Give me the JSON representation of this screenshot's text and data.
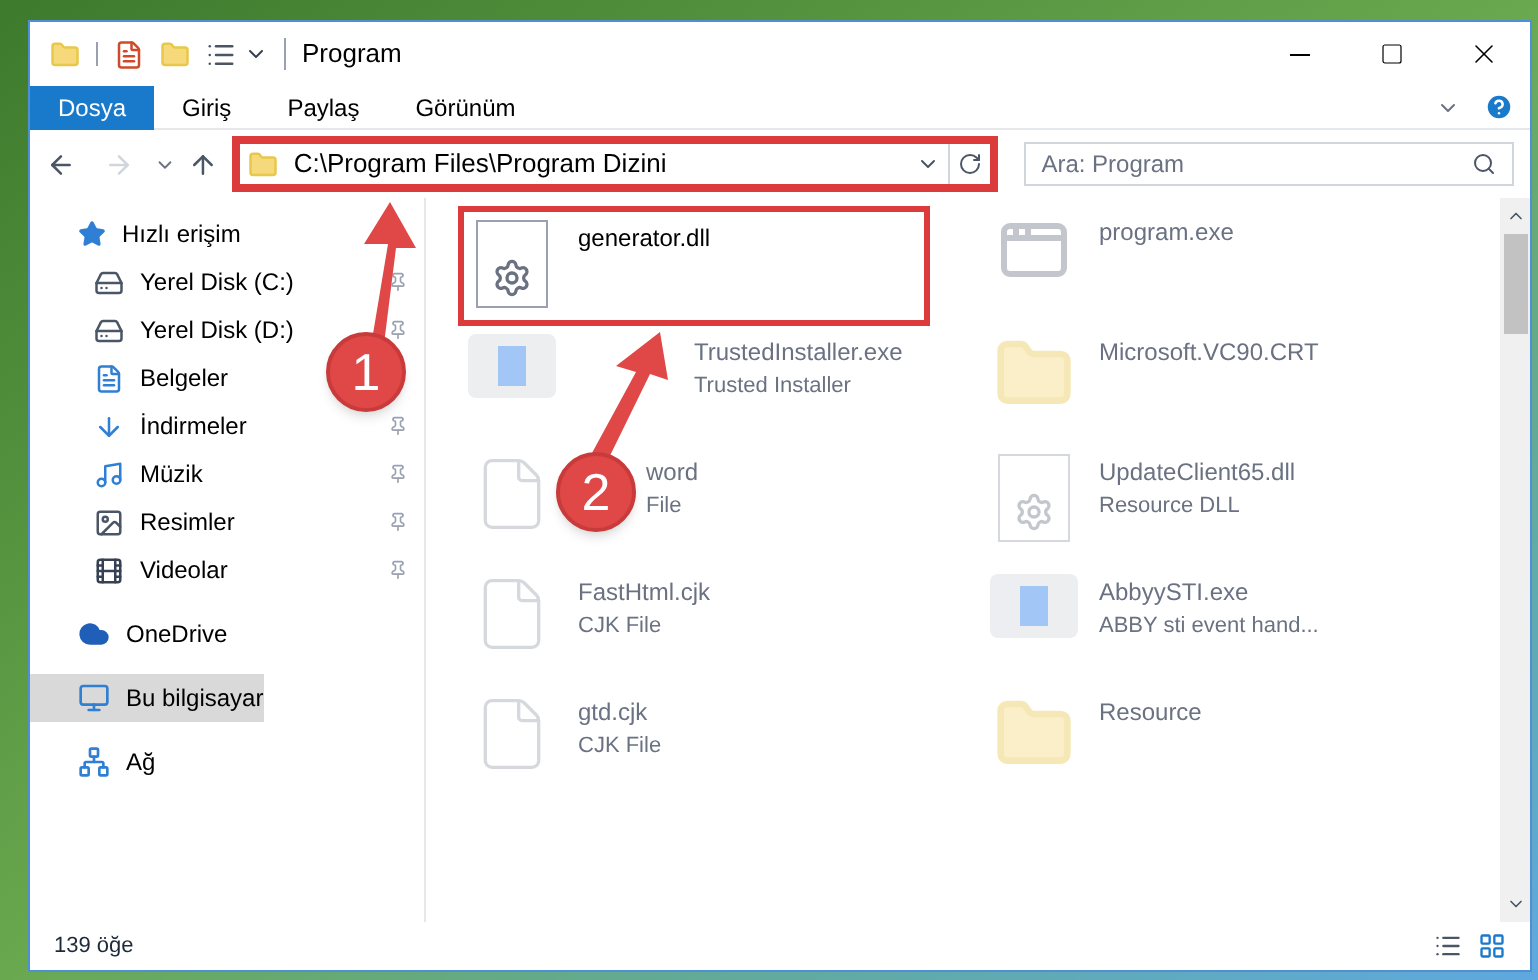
{
  "window": {
    "title": "Program"
  },
  "ribbon_tabs": [
    {
      "label": "Dosya",
      "selected": true
    },
    {
      "label": "Giriş",
      "selected": false
    },
    {
      "label": "Paylaş",
      "selected": false
    },
    {
      "label": "Görünüm",
      "selected": false
    }
  ],
  "address": {
    "path": "C:\\Program Files\\Program Dizini",
    "highlighted": true
  },
  "search": {
    "placeholder": "Ara: Program"
  },
  "sidebar": {
    "items": [
      {
        "label": "Hızlı erişim",
        "kind": "star",
        "selected": false,
        "children": [
          {
            "label": "Yerel Disk (C:)",
            "kind": "drive",
            "pinned": true,
            "selected": false
          },
          {
            "label": "Yerel Disk (D:)",
            "kind": "drive",
            "pinned": true,
            "selected": false
          },
          {
            "label": "Belgeler",
            "kind": "docs",
            "pinned": false,
            "selected": false
          },
          {
            "label": "İndirmeler",
            "kind": "download",
            "pinned": true,
            "selected": false
          },
          {
            "label": "Müzik",
            "kind": "music",
            "pinned": true,
            "selected": false
          },
          {
            "label": "Resimler",
            "kind": "pictures",
            "pinned": true,
            "selected": false
          },
          {
            "label": "Videolar",
            "kind": "video",
            "pinned": true,
            "selected": false
          }
        ]
      },
      {
        "label": "OneDrive",
        "kind": "cloud",
        "selected": false
      },
      {
        "label": "Bu bilgisayar",
        "kind": "computer",
        "selected": true
      },
      {
        "label": "Ağ",
        "kind": "network",
        "selected": false
      }
    ]
  },
  "files": [
    {
      "name": "generator.dll",
      "kind": "gear",
      "faded": false,
      "highlighted": true
    },
    {
      "name": "program.exe",
      "kind": "app",
      "faded": true,
      "highlighted": false
    },
    {
      "name": "TrustedInstaller.exe",
      "subtitle": "Trusted Installer",
      "kind": "window",
      "faded": true,
      "highlighted": false
    },
    {
      "name": "Microsoft.VC90.CRT",
      "kind": "folder",
      "faded": true,
      "highlighted": false
    },
    {
      "name": "word",
      "subtitle": "File",
      "kind": "blank",
      "faded": true,
      "highlighted": false
    },
    {
      "name": "UpdateClient65.dll",
      "subtitle": "Resource DLL",
      "kind": "gear",
      "faded": true,
      "highlighted": false
    },
    {
      "name": "FastHtml.cjk",
      "subtitle": "CJK File",
      "kind": "blank",
      "faded": true,
      "highlighted": false
    },
    {
      "name": "AbbyySTI.exe",
      "subtitle": "ABBY sti event hand...",
      "kind": "window",
      "faded": true,
      "highlighted": false
    },
    {
      "name": "gtd.cjk",
      "subtitle": "CJK File",
      "kind": "blank",
      "faded": true,
      "highlighted": false
    },
    {
      "name": "Resource",
      "kind": "folder",
      "faded": true,
      "highlighted": false
    }
  ],
  "status_bar": {
    "count": "139 öğe"
  },
  "annotations": [
    {
      "label": "1"
    },
    {
      "label": "2"
    }
  ]
}
